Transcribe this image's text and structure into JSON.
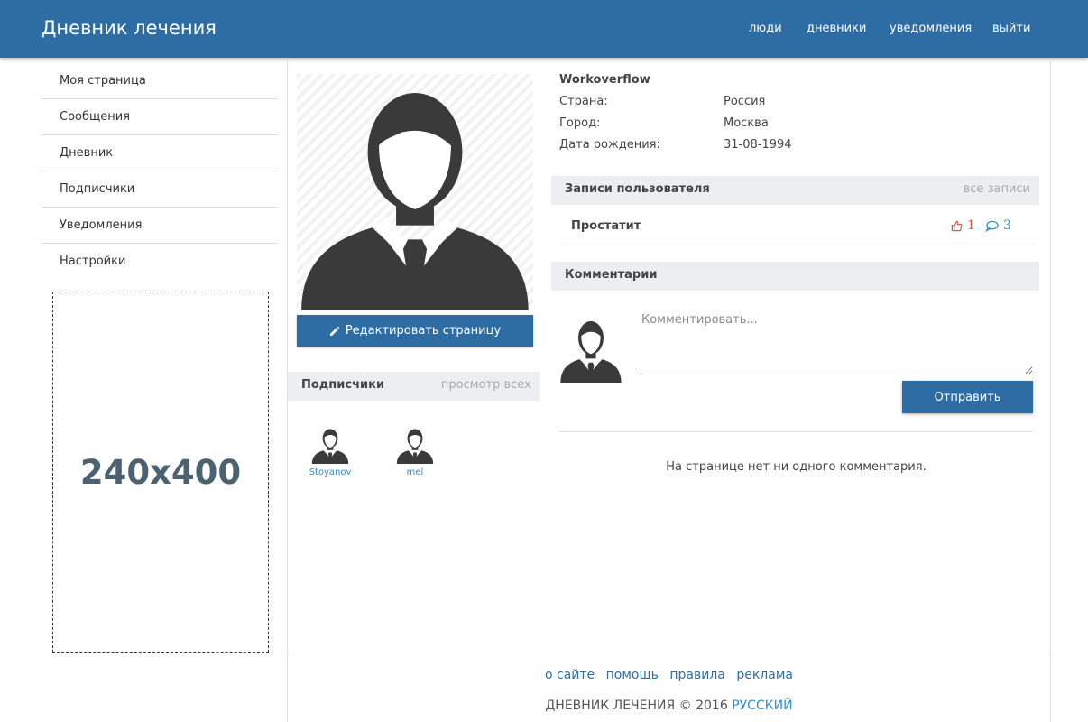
{
  "navbar": {
    "brand": "Дневник лечения",
    "links": [
      "люди",
      "дневники",
      "уведомления",
      "выйти"
    ]
  },
  "sidebar": {
    "items": [
      "Моя страница",
      "Сообщения",
      "Дневник",
      "Подписчики",
      "Уведомления",
      "Настройки"
    ],
    "ad_text": "240x400"
  },
  "profile": {
    "edit_button": "Редактировать страницу",
    "name": "Workoverflow",
    "fields": [
      {
        "label": "Страна:",
        "value": "Россия"
      },
      {
        "label": "Город:",
        "value": "Москва"
      },
      {
        "label": "Дата рождения:",
        "value": "31-08-1994"
      }
    ]
  },
  "subscribers": {
    "title": "Подписчики",
    "view_all": "просмотр всех",
    "users": [
      "Stoyanov",
      "mel"
    ]
  },
  "posts": {
    "title": "Записи пользователя",
    "all_link": "все записи",
    "items": [
      {
        "title": "Простатит",
        "likes": "1",
        "comments": "3"
      }
    ]
  },
  "comments": {
    "title": "Комментарии",
    "placeholder": "Комментировать...",
    "send_button": "Отправить",
    "empty_text": "На странице нет ни одного комментария."
  },
  "footer": {
    "links": [
      "о сайте",
      "помощь",
      "правила",
      "реклама"
    ],
    "copyright": "ДНЕВНИК ЛЕЧЕНИЯ © 2016",
    "language": "РУССКИЙ"
  },
  "colors": {
    "primary": "#2e6da4",
    "link": "#2e8ec9",
    "like": "#d9534f",
    "section_bg": "#eceef0"
  }
}
